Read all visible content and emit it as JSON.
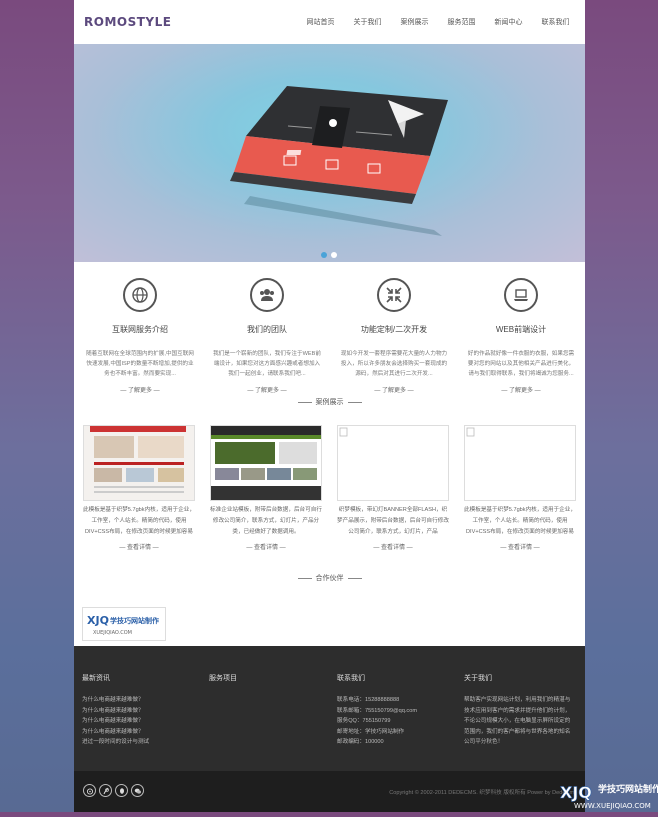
{
  "header": {
    "logo": "ROMOSTYLE",
    "nav": [
      "网站首页",
      "关于我们",
      "案例展示",
      "服务范围",
      "新闻中心",
      "联系我们"
    ]
  },
  "banner": {
    "slides": 2,
    "active_slide": 1
  },
  "services": [
    {
      "icon": "globe-icon",
      "title": "互联网服务介绍",
      "text": "随着互联网在全球范围内的扩展,中国互联网快速发展,中国ISP的数量不断增加,提供的业务也不断丰富。然而要实现...",
      "more": "— 了解更多 —"
    },
    {
      "icon": "team-icon",
      "title": "我们的团队",
      "text": "我们是一个崭新的团队，我们专注于WEB前端设计，如果您对这方面感兴趣或者想加入我们一起创业，请联系我们吧...",
      "more": "— 了解更多 —"
    },
    {
      "icon": "arrows-icon",
      "title": "功能定制/二次开发",
      "text": "现如今开发一套程序需要花大量的人力物力投入，所以许多朋友会选择购买一套现成的源码，然后对其进行二次开发...",
      "more": "— 了解更多 —"
    },
    {
      "icon": "laptop-icon",
      "title": "WEB前端设计",
      "text": "好的作品就好像一件衣服的衣服，如果您需要对您的网站以及其他相关产品进行美化，请与我们取得联系，我们将竭诚为您服务...",
      "more": "— 了解更多 —"
    }
  ],
  "cases_title": "案例展示",
  "cases": [
    {
      "text": "此模板是基于织梦5.7gbk内核，适用于企业，工作室，个人站长。精简的代码，使用DIV+CSS布局，在修改页面的时候更加容易",
      "more": "— 查看详情 —"
    },
    {
      "text": "标准企业站模板，附带后台数据，后台可自行修改公司简介，联系方式，幻灯片，产品分类，已经做好了数据调用。",
      "more": "— 查看详情 —"
    },
    {
      "text": "织梦模板，带幻灯BANNER全部FLASH，织梦产品展示，附带后台数据，后台可自行修改公司简介，联系方式，幻灯片，产品",
      "more": "— 查看详情 —"
    },
    {
      "text": "此模板是基于织梦5.7gbk内核，适用于企业，工作室，个人站长。精简的代码，使用DIV+CSS布局，在修改页面的时候更加容易",
      "more": "— 查看详情 —"
    }
  ],
  "partners_title": "合作伙伴",
  "partner": {
    "brand_mark": "XJQ",
    "name": "学技巧网站制作",
    "domain": "XUEJIQIAO.COM"
  },
  "footer": {
    "news": {
      "title": "最新资讯",
      "items": [
        "为什么电商越来越难做？",
        "为什么电商越来越难做？",
        "为什么电商越来越难做？",
        "为什么电商越来越难做？",
        "进过一段时间的设计与测试"
      ]
    },
    "services": {
      "title": "服务项目"
    },
    "contact": {
      "title": "联系我们",
      "items": [
        "联系电话：15288888888",
        "联系邮箱：755150799@qq.com",
        "服务QQ：755150799",
        "邮寄地址：学技巧网站制作",
        "邮政编码：100000"
      ]
    },
    "about": {
      "title": "关于我们",
      "text": [
        "帮助客户实现网站计划，利用我们的精湛与",
        "技术应用到客户的需求并提升他们的计划，",
        "不论公司规模大小，在电脑显示屏所设定的",
        "范围内，我们的客户都将与世界各地的知名",
        "公司平分秋色！"
      ]
    },
    "copyright": "Copyright © 2002-2011 DEDECMS. 织梦科技 版权所有 Power by DedeCms"
  },
  "watermark": {
    "brand": "XJQ",
    "name": "学技巧网站制作",
    "domain": "WWW.XUEJIQIAO.COM"
  },
  "colors": {
    "accent": "#4aa3d8",
    "logo": "#5c4a7e",
    "footer_bg": "#2d2d2d"
  }
}
